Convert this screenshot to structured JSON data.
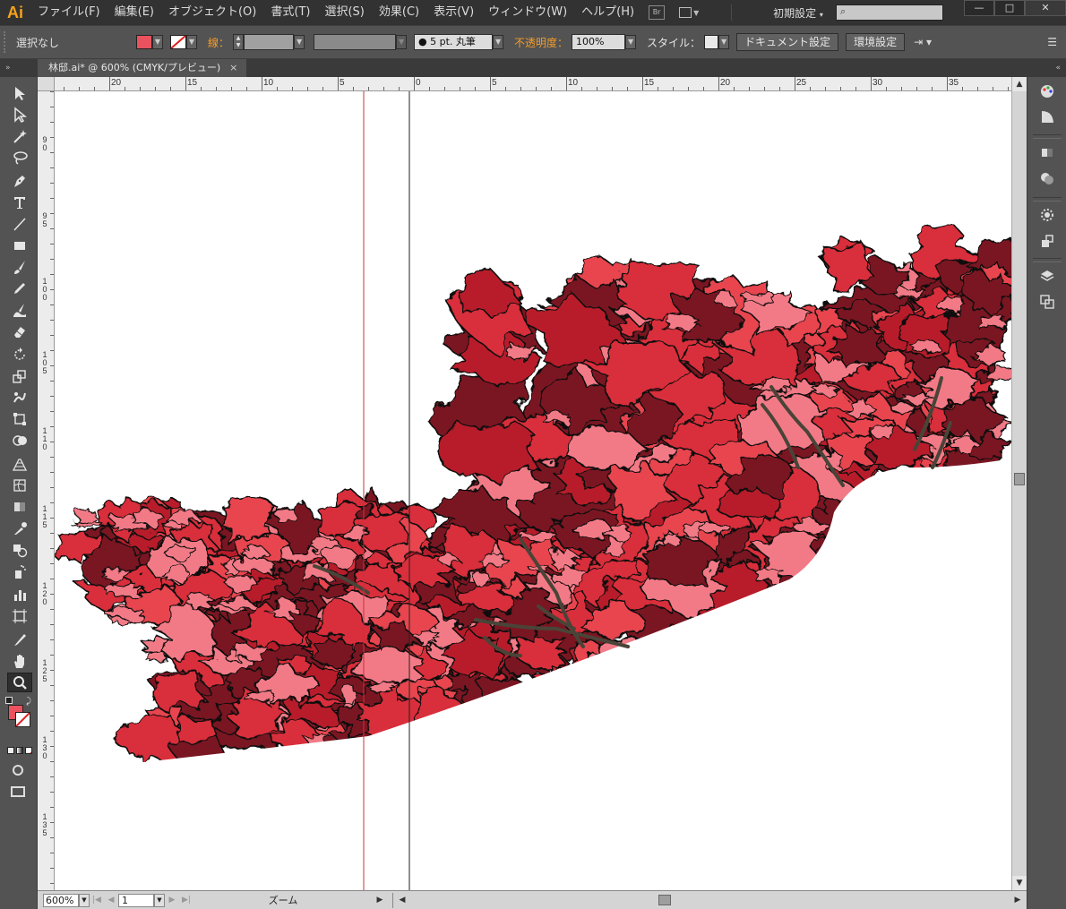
{
  "app": {
    "logo": "Ai",
    "workspace": "初期設定"
  },
  "menu": [
    "ファイル(F)",
    "編集(E)",
    "オブジェクト(O)",
    "書式(T)",
    "選択(S)",
    "効果(C)",
    "表示(V)",
    "ウィンドウ(W)",
    "ヘルプ(H)"
  ],
  "bridge_label": "Br",
  "window": {
    "minimize": "—",
    "maximize": "□",
    "close": "✕"
  },
  "control": {
    "selection": "選択なし",
    "stroke_label": "線：",
    "brush": "● 5 pt. 丸筆",
    "opacity_label": "不透明度：",
    "opacity_value": "100%",
    "style_label": "スタイル：",
    "doc_setup": "ドキュメント設定",
    "prefs": "環境設定"
  },
  "document_tab": {
    "title": "林邸.ai* @ 600% (CMYK/プレビュー)",
    "close": "×"
  },
  "rulers": {
    "horizontal": [
      "20",
      "15",
      "10",
      "5",
      "0",
      "5",
      "10",
      "15",
      "20",
      "25",
      "30",
      "35"
    ],
    "vertical": [
      "90",
      "95",
      "100",
      "105",
      "110",
      "115",
      "120",
      "125",
      "130",
      "135"
    ]
  },
  "status": {
    "zoom": "600%",
    "artboard": "1",
    "tool": "ズーム"
  },
  "colors": {
    "fill": "#e9525e",
    "stroke": "none",
    "guide": "#c8323c",
    "foliage_dark": "#7a1420",
    "foliage_mid": "#d92e3a",
    "foliage_light": "#f27a86",
    "branch": "#4a4438"
  },
  "icons": [
    "selection-icon",
    "direct-selection-icon",
    "magic-wand-icon",
    "lasso-icon",
    "pen-icon",
    "type-icon",
    "line-icon",
    "rectangle-icon",
    "paintbrush-icon",
    "pencil-icon",
    "blob-brush-icon",
    "eraser-icon",
    "rotate-icon",
    "scale-icon",
    "warp-icon",
    "free-transform-icon",
    "shape-builder-icon",
    "perspective-grid-icon",
    "mesh-icon",
    "gradient-icon",
    "eyedropper-icon",
    "blend-icon",
    "symbol-sprayer-icon",
    "column-graph-icon",
    "artboard-icon",
    "slice-icon",
    "hand-icon",
    "zoom-icon"
  ]
}
